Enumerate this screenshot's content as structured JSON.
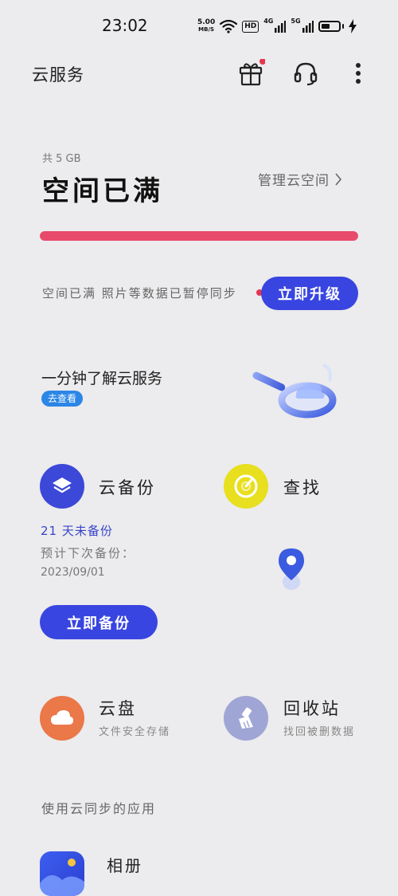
{
  "status_bar": {
    "time": "23:02",
    "net_speed_value": "5.00",
    "net_speed_unit": "MB/S",
    "hd_label": "HD",
    "signal1_label": "4G",
    "signal2_label": "5G"
  },
  "header": {
    "title": "云服务",
    "icons": [
      "gift-icon",
      "headset-icon",
      "more-icon"
    ]
  },
  "storage": {
    "total_label": "共 5 GB",
    "status": "空间已满",
    "manage_label": "管理云空间",
    "usage_fraction": 1.0,
    "usage_color": "#e84a6c",
    "notice": "空间已满 照片等数据已暂停同步",
    "upgrade_label": "立即升级"
  },
  "promo": {
    "title": "一分钟了解云服务",
    "badge": "去查看"
  },
  "features": {
    "backup": {
      "title": "云备份",
      "days_since": "21 天未备份",
      "next_label": "预计下次备份：",
      "next_date": "2023/09/01",
      "button_label": "立即备份"
    },
    "find": {
      "title": "查找"
    },
    "drive": {
      "title": "云盘",
      "subtitle": "文件安全存储"
    },
    "trash": {
      "title": "回收站",
      "subtitle": "找回被删数据"
    }
  },
  "apps_section": {
    "header": "使用云同步的应用",
    "items": [
      {
        "label": "相册"
      }
    ]
  },
  "colors": {
    "accent": "#3845e0",
    "alert": "#e84a6c",
    "background": "#ecebed"
  }
}
